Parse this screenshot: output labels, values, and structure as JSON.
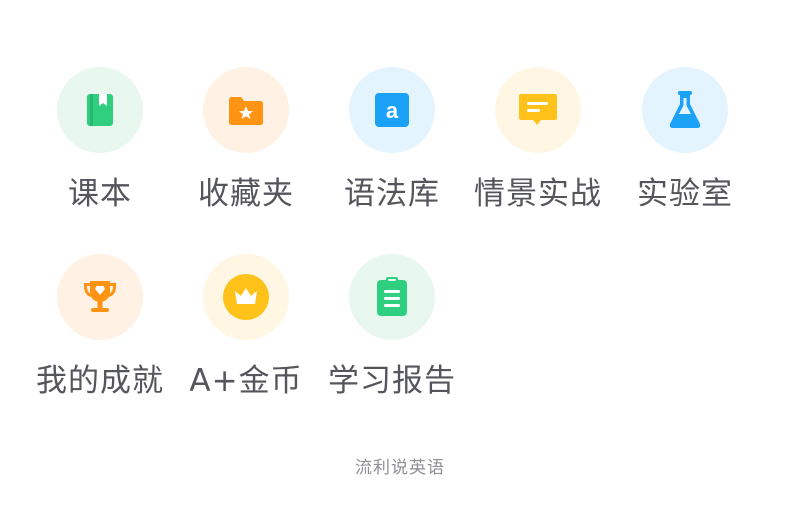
{
  "menu": {
    "items": [
      {
        "label": "课本",
        "icon": "textbook-icon",
        "bg": "#e8f8ef",
        "color": "#2fcf7f"
      },
      {
        "label": "收藏夹",
        "icon": "star-folder-icon",
        "bg": "#fff1e3",
        "color": "#ff9313"
      },
      {
        "label": "语法库",
        "icon": "grammar-a-icon",
        "bg": "#e3f4ff",
        "color": "#1ba1f5"
      },
      {
        "label": "情景实战",
        "icon": "chat-bubble-icon",
        "bg": "#fff7e3",
        "color": "#ffc21a"
      },
      {
        "label": "实验室",
        "icon": "flask-icon",
        "bg": "#e3f4ff",
        "color": "#1ba1f5"
      },
      {
        "label": "我的成就",
        "icon": "trophy-icon",
        "bg": "#fff1e3",
        "color": "#ff9313"
      },
      {
        "label": "A+金币",
        "icon": "crown-coin-icon",
        "bg": "#fff7e3",
        "color": "#ffc21a"
      },
      {
        "label": "学习报告",
        "icon": "clipboard-report-icon",
        "bg": "#e8f8ef",
        "color": "#2fcf7f"
      }
    ]
  },
  "footer": {
    "brand": "流利说英语"
  }
}
